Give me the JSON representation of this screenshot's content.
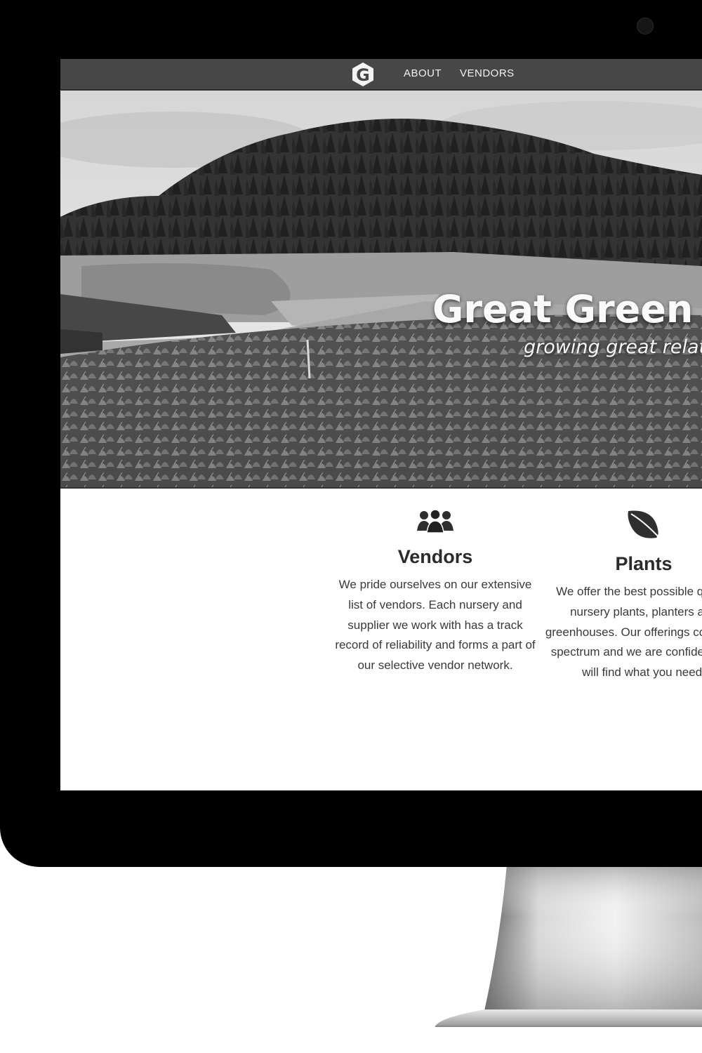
{
  "nav": {
    "logo_letter": "G",
    "links": [
      "ABOUT",
      "VENDORS"
    ]
  },
  "hero": {
    "title": "Great Green S",
    "subtitle": "growing great relatio"
  },
  "features": [
    {
      "icon": "people-group-icon",
      "title": "Vendors",
      "body": "We pride ourselves on our extensive list of vendors. Each nursery and supplier we work with has a track record of reliability and forms a part of our selective vendor network."
    },
    {
      "icon": "leaf-icon",
      "title": "Plants",
      "body": "We offer the best possible quality nursery plants, planters and greenhouses. Our offerings cover the spectrum and we are confident you will find what you need."
    }
  ],
  "colors": {
    "navbar": "#474747",
    "bezel": "#000000",
    "text": "#3a3a3a"
  }
}
